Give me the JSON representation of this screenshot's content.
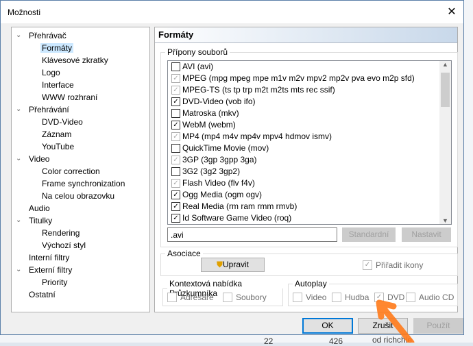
{
  "window": {
    "title": "Možnosti",
    "close": "✕"
  },
  "tree": [
    {
      "label": "Přehrávač",
      "level": 0,
      "toggle": "⌄"
    },
    {
      "label": "Formáty",
      "level": 1,
      "selected": true
    },
    {
      "label": "Klávesové zkratky",
      "level": 1
    },
    {
      "label": "Logo",
      "level": 1
    },
    {
      "label": "Interface",
      "level": 1
    },
    {
      "label": "WWW rozhraní",
      "level": 1
    },
    {
      "label": "Přehrávání",
      "level": 0,
      "toggle": "⌄"
    },
    {
      "label": "DVD-Video",
      "level": 1
    },
    {
      "label": "Záznam",
      "level": 1
    },
    {
      "label": "YouTube",
      "level": 1
    },
    {
      "label": "Video",
      "level": 0,
      "toggle": "⌄"
    },
    {
      "label": "Color correction",
      "level": 1
    },
    {
      "label": "Frame synchronization",
      "level": 1
    },
    {
      "label": "Na celou obrazovku",
      "level": 1
    },
    {
      "label": "Audio",
      "level": 0
    },
    {
      "label": "Titulky",
      "level": 0,
      "toggle": "⌄"
    },
    {
      "label": "Rendering",
      "level": 1
    },
    {
      "label": "Výchozí styl",
      "level": 1
    },
    {
      "label": "Interní filtry",
      "level": 0
    },
    {
      "label": "Externí filtry",
      "level": 0,
      "toggle": "⌄"
    },
    {
      "label": "Priority",
      "level": 1
    },
    {
      "label": "Ostatní",
      "level": 0
    }
  ],
  "panel": {
    "title": "Formáty",
    "extensions_label": "Přípony souborů",
    "formats": [
      {
        "label": "AVI (avi)",
        "state": "off"
      },
      {
        "label": "MPEG (mpg mpeg mpe m1v m2v mpv2 mp2v pva evo m2p sfd)",
        "state": "partial"
      },
      {
        "label": "MPEG-TS (ts tp trp m2t m2ts mts rec ssif)",
        "state": "partial"
      },
      {
        "label": "DVD-Video (vob ifo)",
        "state": "on"
      },
      {
        "label": "Matroska (mkv)",
        "state": "off"
      },
      {
        "label": "WebM (webm)",
        "state": "on"
      },
      {
        "label": "MP4 (mp4 m4v mp4v mpv4 hdmov ismv)",
        "state": "partial"
      },
      {
        "label": "QuickTime Movie (mov)",
        "state": "off"
      },
      {
        "label": "3GP (3gp 3gpp 3ga)",
        "state": "partial"
      },
      {
        "label": "3G2 (3g2 3gp2)",
        "state": "off"
      },
      {
        "label": "Flash Video (flv f4v)",
        "state": "partial"
      },
      {
        "label": "Ogg Media (ogm ogv)",
        "state": "on"
      },
      {
        "label": "Real Media (rm ram rmm rmvb)",
        "state": "on"
      },
      {
        "label": "Id Software Game Video (roq)",
        "state": "on"
      }
    ],
    "ext_value": ".avi",
    "standard_btn": "Standardní",
    "set_btn": "Nastavit",
    "assoc_label": "Asociace",
    "edit_btn": "Upravit",
    "assign_icons": "Přiřadit ikony",
    "context_label": "Kontextová nabídka Průzkumníka",
    "folders": "Adresáře",
    "files": "Soubory",
    "autoplay_label": "Autoplay",
    "video": "Video",
    "music": "Hudba",
    "dvd": "DVD",
    "audiocd": "Audio CD"
  },
  "buttons": {
    "ok": "OK",
    "cancel": "Zrušit",
    "apply": "Použít"
  },
  "background": {
    "n1": "22",
    "n2": "426",
    "link": "od richchie"
  },
  "colors": {
    "accent": "#0078d7",
    "arrow": "#ff7a1a"
  }
}
